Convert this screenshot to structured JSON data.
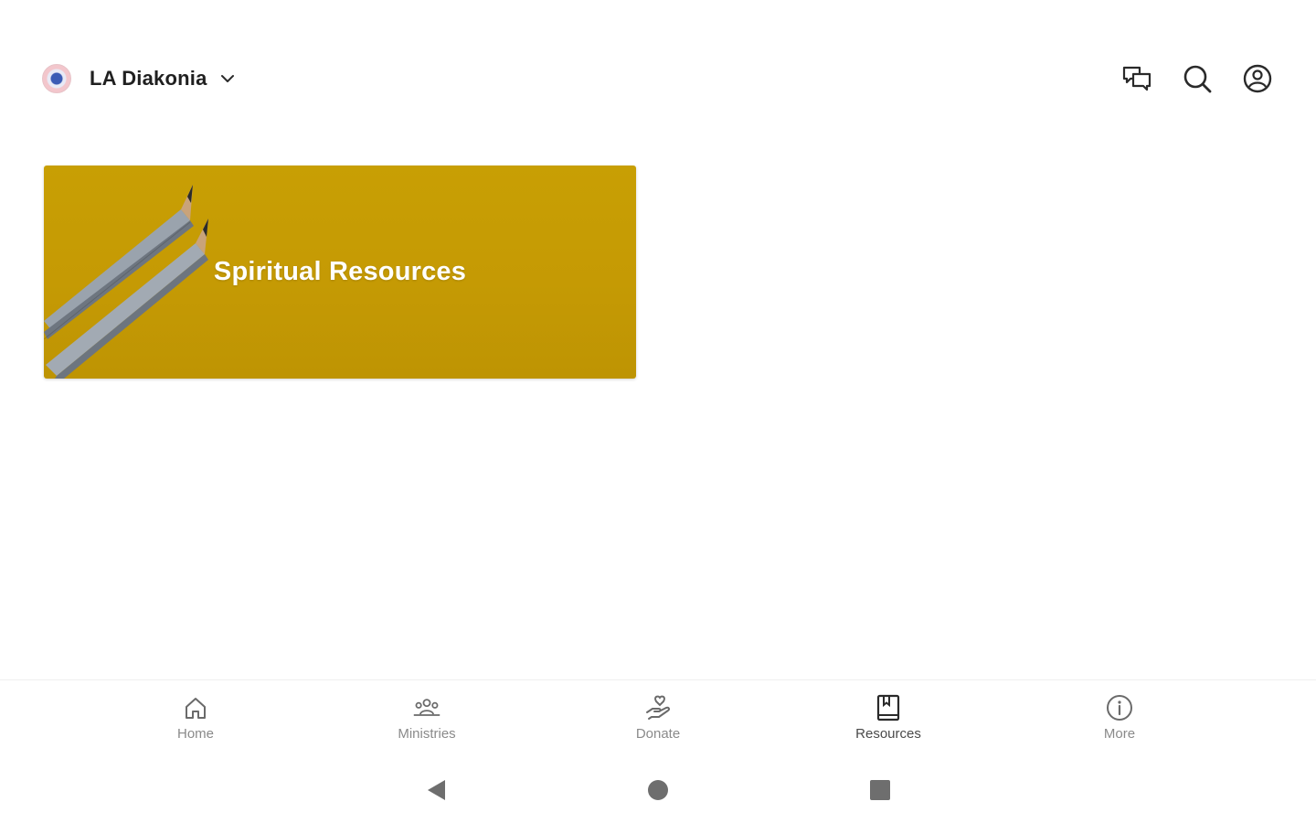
{
  "header": {
    "org_name": "LA Diakonia",
    "actions": [
      {
        "name": "messages-icon"
      },
      {
        "name": "search-icon"
      },
      {
        "name": "profile-icon"
      }
    ]
  },
  "main": {
    "cards": [
      {
        "title": "Spiritual Resources",
        "background_color": "#c89f04"
      }
    ]
  },
  "bottom_nav": {
    "active": "Resources",
    "items": [
      {
        "label": "Home",
        "icon": "home-icon"
      },
      {
        "label": "Ministries",
        "icon": "group-icon"
      },
      {
        "label": "Donate",
        "icon": "donate-icon"
      },
      {
        "label": "Resources",
        "icon": "book-icon"
      },
      {
        "label": "More",
        "icon": "info-icon"
      }
    ]
  },
  "system_nav": {
    "buttons": [
      "back-icon",
      "home-circle-icon",
      "recents-icon"
    ]
  },
  "colors": {
    "icon_dark": "#2a2a2a",
    "nav_inactive": "#8a8a8a",
    "card_gold": "#c89f04"
  }
}
